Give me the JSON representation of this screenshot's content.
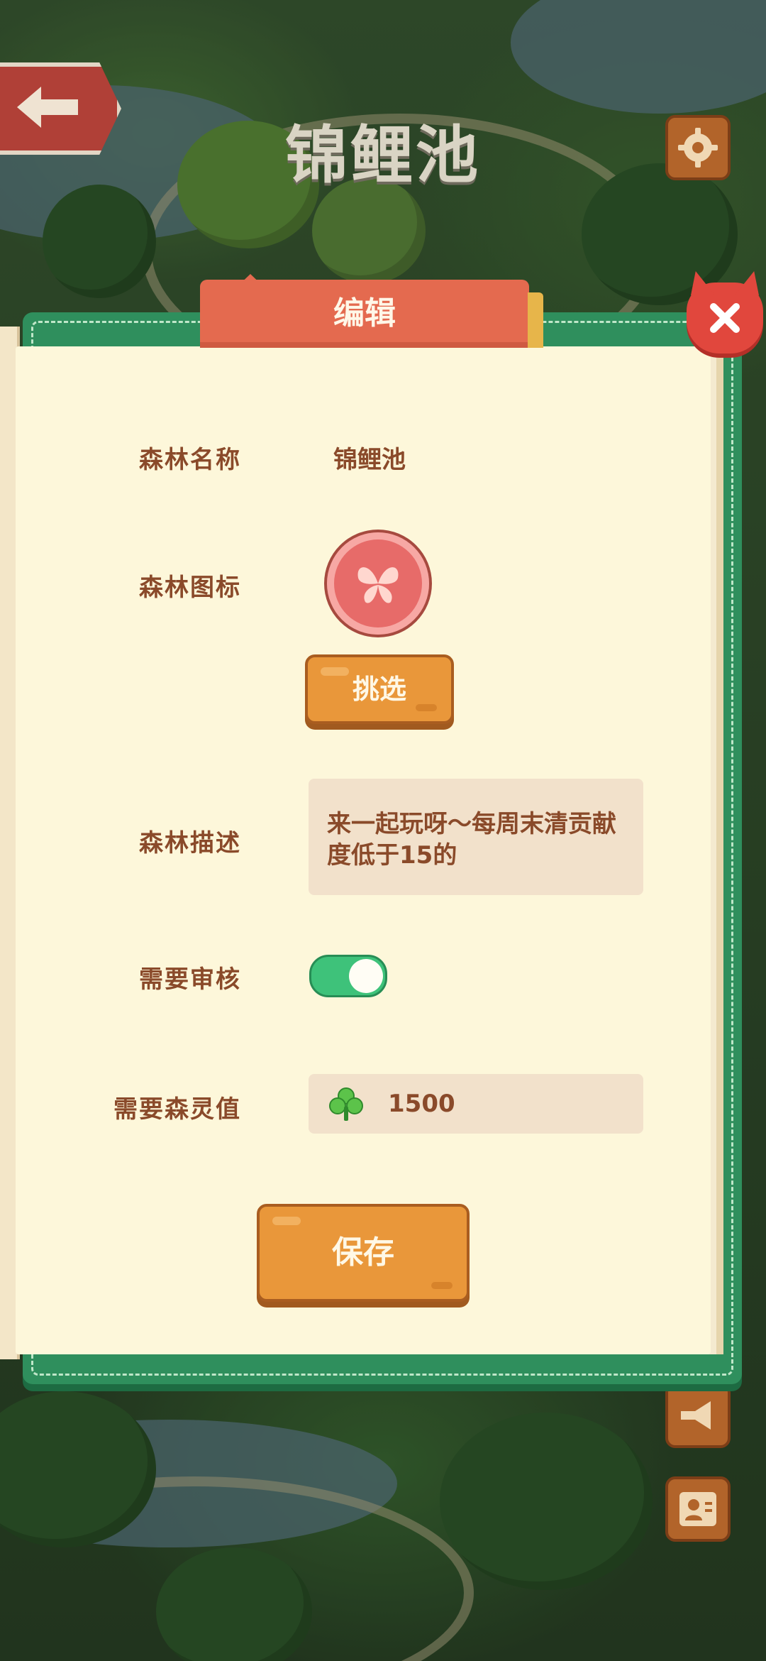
{
  "header": {
    "title": "锦鲤池"
  },
  "dialog": {
    "tab_title": "编辑",
    "fields": {
      "forest_name": {
        "label": "森林名称",
        "value": "锦鲤池"
      },
      "forest_icon": {
        "label": "森林图标",
        "icon": "butterfly-icon",
        "pick_label": "挑选"
      },
      "forest_description": {
        "label": "森林描述",
        "value": "来一起玩呀～每周末清贡献度低于15的"
      },
      "need_review": {
        "label": "需要审核",
        "enabled": true
      },
      "need_spirit_value": {
        "label": "需要森灵值",
        "value": "1500",
        "icon": "clover-icon"
      }
    },
    "save_label": "保存"
  },
  "colors": {
    "panel_green": "#2f8f5d",
    "paper": "#fdf7da",
    "tab_orange": "#e46a4f",
    "text_brown": "#8a4a2a",
    "wood_button": "#e9973a",
    "toggle_on": "#3ec27a",
    "close_red": "#e1473d"
  }
}
